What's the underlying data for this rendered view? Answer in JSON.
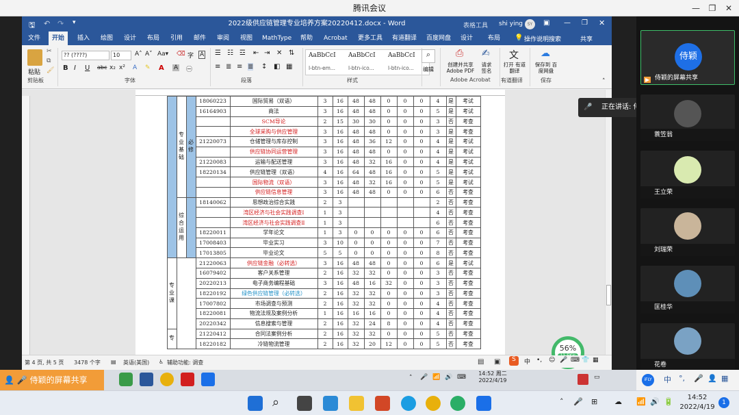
{
  "meeting": {
    "app_title": "腾讯会议",
    "sharing_label": "侍颖的屏幕共享",
    "speaking_label": "正在讲话: 侍颖;",
    "self_name": "侍颖"
  },
  "colors": {
    "word_blue": "#2b579a",
    "share_orange": "#f29c38",
    "red_text": "#d41c1c",
    "teal_text": "#1e8fc6",
    "cell_blue": "#9dc3e6"
  },
  "participants": [
    {
      "name": "侍颖的屏幕共享",
      "avatar": "侍颖"
    },
    {
      "name": "蓑笠翁"
    },
    {
      "name": "王立荣"
    },
    {
      "name": "刘瑞荣"
    },
    {
      "name": "匡桂华"
    },
    {
      "name": "花卷"
    }
  ],
  "word": {
    "title": "2022级供应链管理专业培养方案20220412.docx - Word",
    "table_tools": "表格工具",
    "user": "shi ying",
    "user_initials": "SY",
    "tabs": [
      "文件",
      "开始",
      "插入",
      "绘图",
      "设计",
      "布局",
      "引用",
      "邮件",
      "审阅",
      "视图",
      "MathType",
      "帮助",
      "Acrobat",
      "更多工具",
      "有道翻译",
      "百度网盘",
      "设计",
      "布局"
    ],
    "tell_me": "操作说明搜索",
    "share": "共享",
    "font_name": "?? (????)",
    "font_size": "10",
    "styles": [
      "AaBbCcI",
      "AaBbCcI",
      "AaBbCcI"
    ],
    "style_names": [
      "l-btn-em...",
      "l-btn-ico...",
      "l-btn-ico..."
    ],
    "groups": {
      "clipboard": "剪贴板",
      "font": "字体",
      "paragraph": "段落",
      "styles": "样式",
      "acrobat": "Adobe Acrobat",
      "youdao": "有道翻译",
      "save": "保存"
    },
    "paste": "粘贴",
    "edit": "编辑",
    "acrobat_btn1": "创建并共享 Adobe PDF",
    "acrobat_btn2": "请求 签名",
    "youdao_btn": "打开 有道翻译",
    "save_btn": "保存到 百度网盘",
    "status": {
      "page": "第 4 页, 共 5 页",
      "words": "3478 个字",
      "lang": "英语(美国)",
      "access": "辅助功能: 调查"
    }
  },
  "table": {
    "rows": [
      {
        "code": "18060223",
        "name": "国际贸易（双语）",
        "c": [
          "3",
          "16",
          "48",
          "48",
          "0",
          "0",
          "0",
          "4",
          "是",
          "考试"
        ]
      },
      {
        "code": "16164903",
        "name": "商法",
        "c": [
          "3",
          "16",
          "48",
          "48",
          "0",
          "0",
          "0",
          "5",
          "是",
          "考试"
        ]
      },
      {
        "code": "",
        "name": "SCM导论",
        "red": true,
        "c": [
          "2",
          "15",
          "30",
          "30",
          "0",
          "0",
          "0",
          "3",
          "否",
          "考查"
        ]
      },
      {
        "code": "",
        "name": "全球采购与供应管理",
        "red": true,
        "c": [
          "3",
          "16",
          "48",
          "48",
          "0",
          "0",
          "0",
          "3",
          "是",
          "考查"
        ]
      },
      {
        "code": "21220073",
        "name": "仓储管理与库存控制",
        "c": [
          "3",
          "16",
          "48",
          "36",
          "12",
          "0",
          "0",
          "4",
          "是",
          "考试"
        ]
      },
      {
        "code": "",
        "name": "供应链协同运营管理",
        "red": true,
        "c": [
          "3",
          "16",
          "48",
          "48",
          "0",
          "0",
          "0",
          "4",
          "是",
          "考试"
        ]
      },
      {
        "code": "21220083",
        "name": "运输与配送管理",
        "c": [
          "3",
          "16",
          "48",
          "32",
          "16",
          "0",
          "0",
          "4",
          "是",
          "考试"
        ]
      },
      {
        "code": "18220134",
        "name": "供应链管理（双语）",
        "c": [
          "4",
          "16",
          "64",
          "48",
          "16",
          "0",
          "0",
          "5",
          "是",
          "考试"
        ]
      },
      {
        "code": "",
        "name": "国际物流（双语）",
        "red": true,
        "c": [
          "3",
          "16",
          "48",
          "32",
          "16",
          "0",
          "0",
          "5",
          "是",
          "考试"
        ]
      },
      {
        "code": "",
        "name": "供应链信息管理",
        "red": true,
        "c": [
          "3",
          "16",
          "48",
          "48",
          "0",
          "0",
          "0",
          "6",
          "否",
          "考查"
        ]
      },
      {
        "code": "18140062",
        "name": "思想政治综合实践",
        "c": [
          "2",
          "3",
          "",
          "",
          "",
          "",
          "",
          "2",
          "否",
          "考查"
        ]
      },
      {
        "code": "",
        "name": "湾区经济与社会实践调查Ⅰ",
        "red": true,
        "c": [
          "1",
          "3",
          "",
          "",
          "",
          "",
          "",
          "4",
          "否",
          "考查"
        ]
      },
      {
        "code": "",
        "name": "湾区经济与社会实践调查Ⅱ",
        "red": true,
        "c": [
          "1",
          "3",
          "",
          "",
          "",
          "",
          "",
          "6",
          "否",
          "考查"
        ]
      },
      {
        "code": "18220011",
        "name": "学年论文",
        "c": [
          "1",
          "3",
          "0",
          "0",
          "0",
          "0",
          "0",
          "6",
          "否",
          "考查"
        ]
      },
      {
        "code": "17008403",
        "name": "毕业实习",
        "c": [
          "3",
          "10",
          "0",
          "0",
          "0",
          "0",
          "0",
          "7",
          "否",
          "考查"
        ]
      },
      {
        "code": "17013805",
        "name": "毕业论文",
        "c": [
          "5",
          "5",
          "0",
          "0",
          "0",
          "0",
          "0",
          "8",
          "否",
          "考查"
        ]
      },
      {
        "code": "21220063",
        "name": "供应链金融（必转选）",
        "red": true,
        "c": [
          "3",
          "16",
          "48",
          "48",
          "0",
          "0",
          "0",
          "6",
          "是",
          "考试"
        ]
      },
      {
        "code": "16079402",
        "name": "客户关系管理",
        "c": [
          "2",
          "16",
          "32",
          "32",
          "0",
          "0",
          "0",
          "3",
          "否",
          "考查"
        ]
      },
      {
        "code": "20220213",
        "name": "电子商务编程基础",
        "c": [
          "3",
          "16",
          "48",
          "16",
          "32",
          "0",
          "0",
          "3",
          "否",
          "考查"
        ]
      },
      {
        "code": "18220192",
        "name": "绿色供应链管理（必转选）",
        "teal": true,
        "c": [
          "2",
          "16",
          "32",
          "32",
          "0",
          "0",
          "0",
          "3",
          "否",
          "考查"
        ]
      },
      {
        "code": "17007802",
        "name": "市场调查与预测",
        "c": [
          "2",
          "16",
          "32",
          "32",
          "0",
          "0",
          "0",
          "4",
          "否",
          "考查"
        ]
      },
      {
        "code": "18220081",
        "name": "物流法规及案例分析",
        "c": [
          "1",
          "16",
          "16",
          "16",
          "0",
          "0",
          "0",
          "4",
          "否",
          "考查"
        ]
      },
      {
        "code": "20220342",
        "name": "信息搜索与管理",
        "c": [
          "2",
          "16",
          "32",
          "24",
          "8",
          "0",
          "0",
          "4",
          "否",
          "考查"
        ]
      },
      {
        "code": "21220412",
        "name": "合同法案例分析",
        "c": [
          "2",
          "16",
          "32",
          "32",
          "0",
          "0",
          "0",
          "5",
          "否",
          "考查"
        ]
      },
      {
        "code": "18220182",
        "name": "冷链物流管理",
        "c": [
          "2",
          "16",
          "32",
          "20",
          "12",
          "0",
          "0",
          "5",
          "否",
          "考查"
        ]
      }
    ],
    "group_a": "专业基础",
    "group_a2": "必修",
    "group_b": "综合运用",
    "group_c": "专业课",
    "group_d": "专"
  },
  "tray": {
    "time": "14:52 周二",
    "date": "2022/4/19",
    "time2": "14:52",
    "date2": "2022/4/19",
    "net": "56%",
    "net_speed": "11.5K/s",
    "ime": "中",
    "badge": "1",
    "weekday": "周二"
  }
}
